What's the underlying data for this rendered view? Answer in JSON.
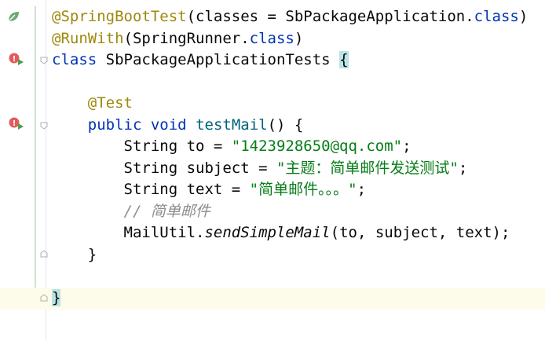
{
  "editor": {
    "lines": [
      {
        "segments": [
          {
            "t": "@SpringBootTest",
            "c": "anno"
          },
          {
            "t": "(classes = SbPackageApplication.",
            "c": ""
          },
          {
            "t": "class",
            "c": "kw"
          },
          {
            "t": ")",
            "c": ""
          }
        ]
      },
      {
        "segments": [
          {
            "t": "@RunWith",
            "c": "anno"
          },
          {
            "t": "(SpringRunner.",
            "c": ""
          },
          {
            "t": "class",
            "c": "kw"
          },
          {
            "t": ")",
            "c": ""
          }
        ]
      },
      {
        "segments": [
          {
            "t": "class",
            "c": "kw"
          },
          {
            "t": " SbPackageApplicationTests ",
            "c": ""
          },
          {
            "t": "{",
            "c": "brace"
          }
        ]
      },
      {
        "segments": []
      },
      {
        "segments": [
          {
            "t": "    @Test",
            "c": "anno"
          }
        ]
      },
      {
        "segments": [
          {
            "t": "    ",
            "c": ""
          },
          {
            "t": "public void",
            "c": "kw"
          },
          {
            "t": " ",
            "c": ""
          },
          {
            "t": "testMail",
            "c": "fn"
          },
          {
            "t": "() {",
            "c": ""
          }
        ]
      },
      {
        "segments": [
          {
            "t": "        String to = ",
            "c": ""
          },
          {
            "t": "\"1423928650@qq.com\"",
            "c": "str"
          },
          {
            "t": ";",
            "c": ""
          }
        ]
      },
      {
        "segments": [
          {
            "t": "        String subject = ",
            "c": ""
          },
          {
            "t": "\"主题：简单邮件发送测试\"",
            "c": "str"
          },
          {
            "t": ";",
            "c": ""
          }
        ]
      },
      {
        "segments": [
          {
            "t": "        String text = ",
            "c": ""
          },
          {
            "t": "\"简单邮件。。。\"",
            "c": "str"
          },
          {
            "t": ";",
            "c": ""
          }
        ]
      },
      {
        "segments": [
          {
            "t": "        ",
            "c": ""
          },
          {
            "t": "// 简单邮件",
            "c": "cmt"
          }
        ]
      },
      {
        "segments": [
          {
            "t": "        MailUtil.",
            "c": ""
          },
          {
            "t": "sendSimpleMail",
            "c": "it"
          },
          {
            "t": "(to, subject, text);",
            "c": ""
          }
        ]
      },
      {
        "segments": [
          {
            "t": "    }",
            "c": ""
          }
        ]
      },
      {
        "segments": []
      },
      {
        "segments": [
          {
            "t": "}",
            "c": "brace"
          }
        ]
      }
    ]
  },
  "gutter": {
    "leaf_icon": "spring-leaf-icon",
    "run_icons": [
      "run-test-icon",
      "run-test-icon"
    ],
    "fold_icons": [
      "fold-icon",
      "fold-icon",
      "fold-icon"
    ],
    "accent_color": "#6aab73"
  }
}
